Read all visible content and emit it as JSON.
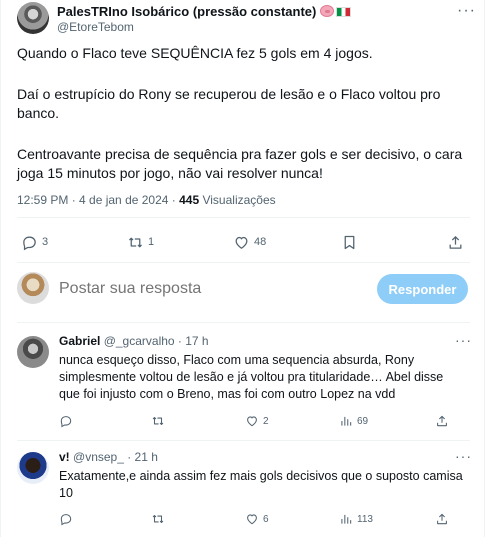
{
  "tweet": {
    "author_name": "PalesTRIno Isobárico (pressão constante)",
    "author_handle": "@EtoreTebom",
    "paragraphs": [
      "Quando o Flaco teve SEQUÊNCIA fez 5 gols em 4 jogos.",
      "Daí o estrupício do Rony se recuperou de lesão e o Flaco voltou pro banco.",
      "Centroavante precisa de sequência pra fazer gols e ser decisivo, o cara joga 15 minutos por jogo, não vai resolver nunca!"
    ],
    "time": "12:59 PM · 4 de jan de 2024 · ",
    "views_count": "445",
    "views_label": " Visualizações",
    "stats": {
      "replies": "3",
      "retweets": "1",
      "likes": "48"
    }
  },
  "composer": {
    "placeholder": "Postar sua resposta",
    "button_label": "Responder"
  },
  "replies": [
    {
      "name": "Gabriel",
      "handle_time": "@_gcarvalho · 17 h",
      "text": "nunca esqueço disso, Flaco com uma sequencia absurda, Rony simplesmente voltou de lesão e já voltou pra titularidade… Abel disse que foi injusto com o Breno, mas foi com outro Lopez na vdd",
      "likes": "2",
      "views": "69"
    },
    {
      "name": "v!",
      "handle_time": "@vnsep_ · 21 h",
      "text": "Exatamente,e ainda assim fez mais gols decisivos que o suposto camisa 10",
      "likes": "6",
      "views": "113"
    }
  ],
  "colors": {
    "text": "#0f1419",
    "secondary": "#536471",
    "divider": "#eff3f4",
    "button_disabled": "#8ecdf8"
  },
  "icons": [
    "more-icon",
    "reply-icon",
    "retweet-icon",
    "like-icon",
    "bookmark-icon",
    "share-icon",
    "views-icon",
    "pig-emoji",
    "italy-flag"
  ]
}
